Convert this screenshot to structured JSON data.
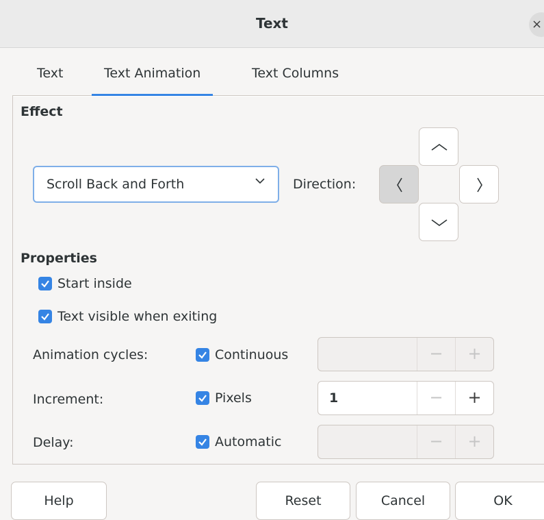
{
  "window": {
    "title": "Text",
    "close_glyph": "×"
  },
  "tabs": [
    {
      "label": "Text",
      "active": false
    },
    {
      "label": "Text Animation",
      "active": true
    },
    {
      "label": "Text Columns",
      "active": false
    }
  ],
  "effect": {
    "heading": "Effect",
    "selected": "Scroll Back and Forth",
    "direction_label": "Direction:",
    "direction_pressed": "left"
  },
  "properties": {
    "heading": "Properties",
    "start_inside": {
      "label": "Start inside",
      "checked": true
    },
    "text_visible": {
      "label": "Text visible when exiting",
      "checked": true
    },
    "animation_cycles": {
      "label": "Animation cycles:",
      "check_label": "Continuous",
      "checked": true,
      "value": ""
    },
    "increment": {
      "label": "Increment:",
      "check_label": "Pixels",
      "checked": true,
      "value": "1"
    },
    "delay": {
      "label": "Delay:",
      "check_label": "Automatic",
      "checked": true,
      "value": ""
    }
  },
  "spin": {
    "minus": "−",
    "plus": "+"
  },
  "buttons": {
    "help": "Help",
    "reset": "Reset",
    "cancel": "Cancel",
    "ok": "OK"
  },
  "colors": {
    "accent": "#3584e4",
    "focus_border": "#7eaee8",
    "background": "#f6f5f4"
  }
}
